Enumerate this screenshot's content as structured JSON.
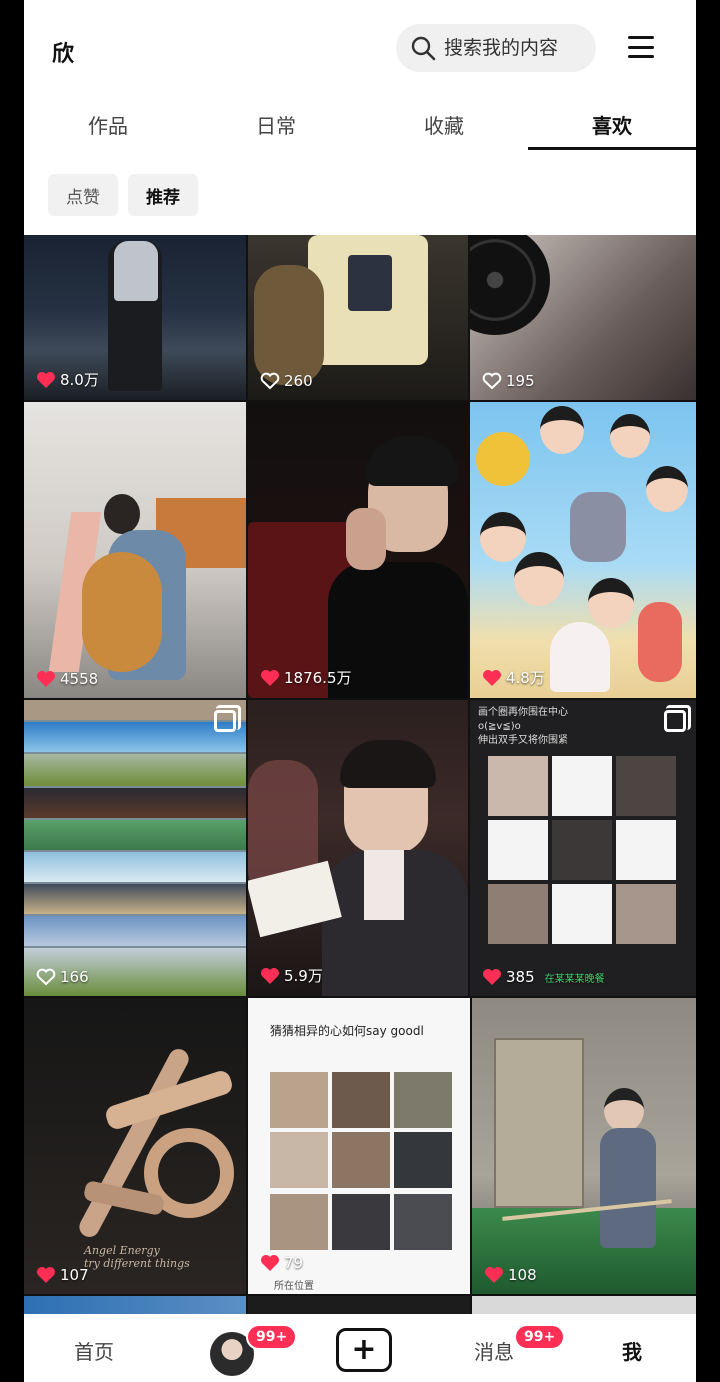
{
  "header": {
    "user_name": "欣",
    "search_placeholder": "搜索我的内容"
  },
  "tabs": [
    {
      "label": "作品",
      "active": false
    },
    {
      "label": "日常",
      "active": false
    },
    {
      "label": "收藏",
      "active": false
    },
    {
      "label": "喜欢",
      "active": true
    }
  ],
  "sub_tabs": [
    {
      "label": "点赞",
      "active": false
    },
    {
      "label": "推荐",
      "active": true
    }
  ],
  "posts": [
    {
      "likes": "8.0万",
      "liked": true
    },
    {
      "likes": "260",
      "liked": false
    },
    {
      "likes": "195",
      "liked": false
    },
    {
      "likes": "4558",
      "liked": true
    },
    {
      "likes": "1876.5万",
      "liked": true
    },
    {
      "likes": "4.8万",
      "liked": true
    },
    {
      "likes": "166",
      "liked": false
    },
    {
      "likes": "5.9万",
      "liked": true
    },
    {
      "likes": "385",
      "liked": true,
      "extra": "在某某某晚餐"
    },
    {
      "likes": "107",
      "liked": true
    },
    {
      "likes": "79",
      "liked": true
    },
    {
      "likes": "108",
      "liked": true
    }
  ],
  "post_texts": {
    "grid_note_line1": "画个圈再你围在中心",
    "grid_note_line2": "o(≧v≦)o",
    "grid_note_line3": "伸出双手又将你围紧",
    "collage_title": "猜猜相异的心如何say goodl",
    "art_script": "Angel Energy",
    "art_script2": "try different things",
    "bottom_partial": "所在位置"
  },
  "bottom_nav": {
    "home": "首页",
    "friends_badge": "99+",
    "messages": "消息",
    "messages_badge": "99+",
    "me": "我"
  },
  "colors": {
    "like_red": "#ff2e55",
    "badge_red": "#ff2e55"
  }
}
